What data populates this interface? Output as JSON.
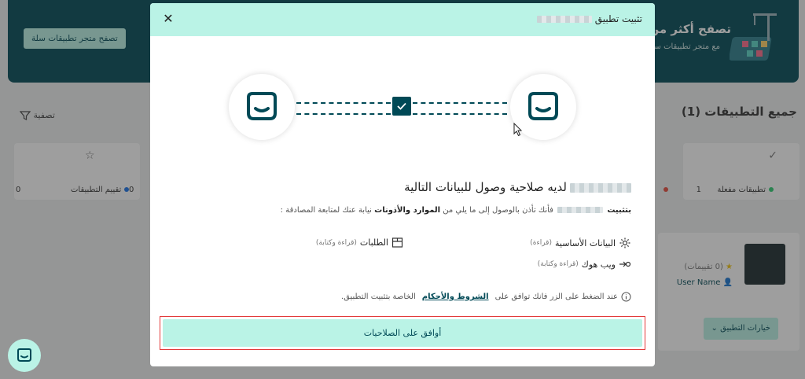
{
  "background": {
    "hero": {
      "title": "تصفح أكثر من",
      "subtitle": "مع متجر تطبيقات سلة",
      "browse_button": "تصفح متجر تطبيقات سلة"
    },
    "apps_title": "جميع التطبيقات (1)",
    "filter_label": "تصفية",
    "stats": [
      {
        "label": "تطبيقات مفعلة",
        "value": "1",
        "dot_color": "#2ecc71"
      },
      {
        "label": "تقييم التطبيقات",
        "value": "0",
        "dot_color": "#1a73e8"
      },
      {
        "label": "",
        "value": "0",
        "dot_color": "#e74c3c"
      }
    ],
    "app_card": {
      "rating": "(0 تقييمات)",
      "username": "User Name",
      "options_button": "خيارات التطبيق"
    }
  },
  "modal": {
    "title": "تثبيت تطبيق",
    "close_icon": "close-icon",
    "heading": "لديه صلاحية وصول للبيانات التالية",
    "desc_prefix": "بتثبيت",
    "desc_middle": "فأنك تأذن بالوصول إلى ما يلي من",
    "desc_bold": "الموارد والأذونات",
    "desc_suffix": "نيابة عنك لمتابعة المصادقة :",
    "permissions": [
      {
        "name": "البيانات الأساسية",
        "access": "(قراءة)",
        "icon": "gear-icon"
      },
      {
        "name": "الطلبات",
        "access": "(قراءة وكتابة)",
        "icon": "box-icon"
      },
      {
        "name": "ويب هوك",
        "access": "(قراءة وكتابة)",
        "icon": "webhook-icon"
      }
    ],
    "terms_prefix": "عند الضغط على الزر فانك توافق على",
    "terms_link": "الشروط والأحكام",
    "terms_suffix": "الخاصة بتثبيت التطبيق.",
    "agree_button": "أوافق على الصلاحيات"
  },
  "colors": {
    "primary": "#004956",
    "accent": "#baf3e6",
    "highlight_border": "#e23b3b"
  }
}
